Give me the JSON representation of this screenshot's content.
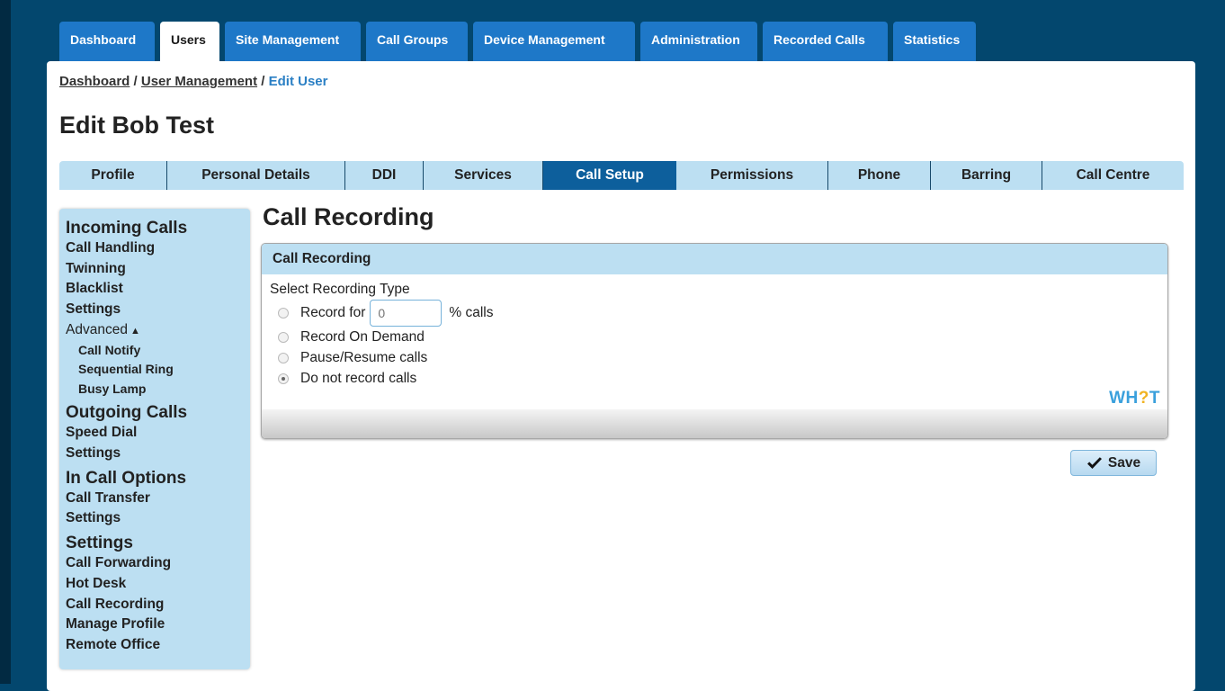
{
  "top_nav": {
    "tabs": [
      {
        "label": "Dashboard"
      },
      {
        "label": "Users"
      },
      {
        "label": "Site Management"
      },
      {
        "label": "Call Groups"
      },
      {
        "label": "Device Management"
      },
      {
        "label": "Administration"
      },
      {
        "label": "Recorded Calls"
      },
      {
        "label": "Statistics"
      }
    ],
    "active": "Users"
  },
  "breadcrumb": {
    "items": [
      "Dashboard",
      "User Management"
    ],
    "separator": "/",
    "current": "Edit User"
  },
  "page_title": "Edit Bob Test",
  "sub_tabs": {
    "tabs": [
      {
        "label": "Profile"
      },
      {
        "label": "Personal Details"
      },
      {
        "label": "DDI"
      },
      {
        "label": "Services"
      },
      {
        "label": "Call Setup"
      },
      {
        "label": "Permissions"
      },
      {
        "label": "Phone"
      },
      {
        "label": "Barring"
      },
      {
        "label": "Call Centre"
      }
    ],
    "active": "Call Setup"
  },
  "sidebar": {
    "incoming": {
      "title": "Incoming Calls",
      "items": [
        "Call Handling",
        "Twinning",
        "Blacklist",
        "Settings"
      ],
      "advanced": {
        "label": "Advanced",
        "items": [
          "Call Notify",
          "Sequential Ring",
          "Busy Lamp"
        ]
      }
    },
    "outgoing": {
      "title": "Outgoing Calls",
      "items": [
        "Speed Dial",
        "Settings"
      ]
    },
    "in_call": {
      "title": "In Call Options",
      "items": [
        "Call Transfer",
        "Settings"
      ]
    },
    "settings": {
      "title": "Settings",
      "items": [
        "Call Forwarding",
        "Hot Desk",
        "Call Recording",
        "Manage Profile",
        "Remote Office"
      ]
    }
  },
  "content": {
    "title": "Call Recording",
    "box_header": "Call Recording",
    "field_label": "Select Recording Type",
    "options": {
      "record_for_prefix": "Record for",
      "percent_value": "",
      "percent_placeholder": "0",
      "record_for_suffix": "% calls",
      "on_demand": "Record On Demand",
      "pause_resume": "Pause/Resume calls",
      "do_not_record": "Do not record calls"
    },
    "selected_option": "Do not record calls",
    "logo_text": {
      "part1": "WH",
      "part2": "?",
      "part3": "T"
    },
    "save_label": "Save"
  },
  "colors": {
    "background": "#03476e",
    "tab_blue": "#1e78c8",
    "active_sub_tab": "#0d5f9c",
    "light_blue": "#bcdff2",
    "breadcrumb_current": "#2a7fc4",
    "logo_blue": "#3aa0dc",
    "logo_yellow": "#f0b323"
  }
}
